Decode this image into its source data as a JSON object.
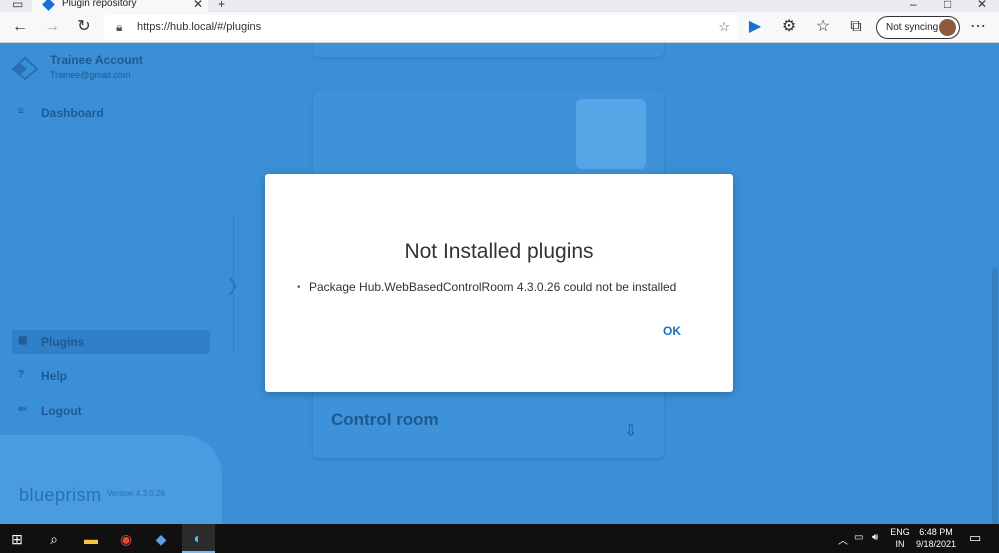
{
  "browser": {
    "tab_title": "Plugin repository",
    "url": "https://hub.local/#/plugins",
    "sync_label": "Not syncing"
  },
  "sidebar": {
    "account_name": "Trainee Account",
    "account_email": "Trainee@gmail.com",
    "items": [
      {
        "label": "Dashboard"
      },
      {
        "label": "Plugins"
      },
      {
        "label": "Help"
      },
      {
        "label": "Logout"
      }
    ],
    "brand": "blueprism",
    "version": "Version 4.3.0.26"
  },
  "main": {
    "card_title": "Control room"
  },
  "modal": {
    "title": "Not Installed plugins",
    "items": [
      "Package Hub.WebBasedControlRoom 4.3.0.26 could not be installed"
    ],
    "ok_label": "OK"
  },
  "taskbar": {
    "lang_line1": "ENG",
    "lang_line2": "IN",
    "time": "6:48 PM",
    "date": "9/18/2021"
  },
  "colors": {
    "accent": "#1e6fc4",
    "overlay": "#3b8fd6"
  }
}
